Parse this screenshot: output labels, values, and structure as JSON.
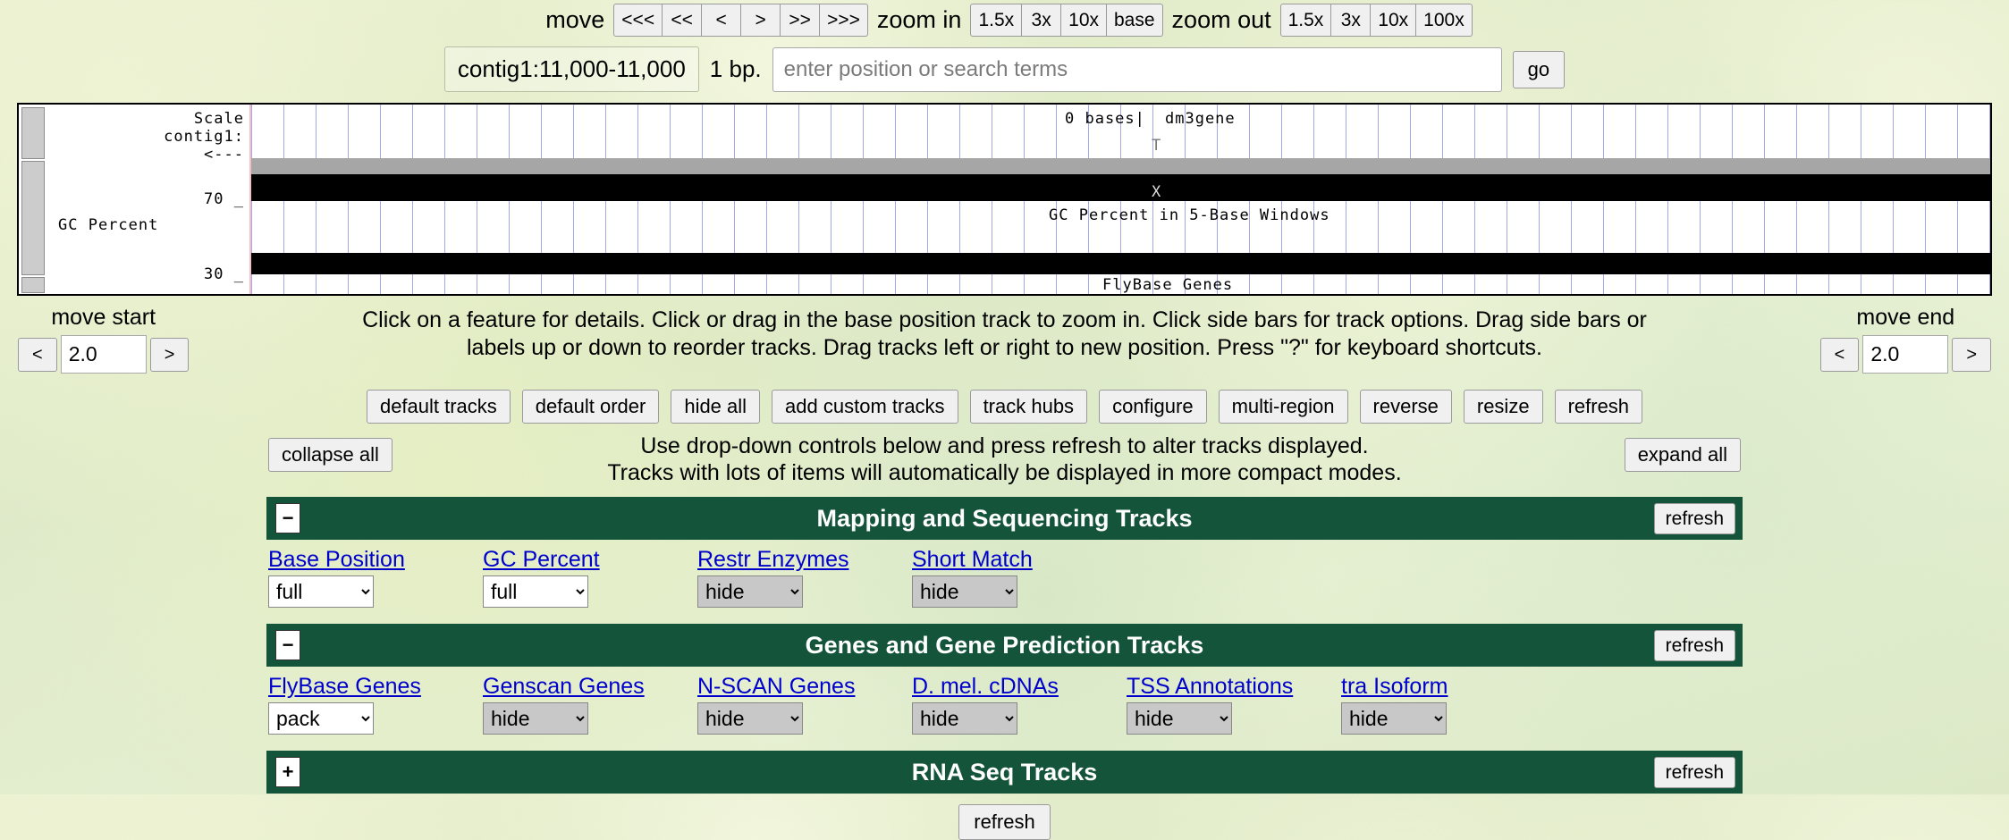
{
  "topnav": {
    "move_label": "move",
    "move_buttons": [
      "<<<",
      "<<",
      "<",
      ">",
      ">>",
      ">>>"
    ],
    "zoom_in_label": "zoom in",
    "zoom_in_buttons": [
      "1.5x",
      "3x",
      "10x",
      "base"
    ],
    "zoom_out_label": "zoom out",
    "zoom_out_buttons": [
      "1.5x",
      "3x",
      "10x",
      "100x"
    ]
  },
  "position": {
    "value": "contig1:11,000-11,000",
    "size": "1 bp.",
    "search_placeholder": "enter position or search terms",
    "search_value": "",
    "go_label": "go"
  },
  "browser_image": {
    "scale_label": "Scale",
    "contig_label": "contig1:",
    "arrow_label": "<---",
    "bases_label": "0 bases|",
    "assembly_label": "dm3gene",
    "base_letter_top": "T",
    "base_letter_bottom": "X",
    "gc_axis_high": "70 _",
    "gc_axis_low": "30 _",
    "gc_side_label": "GC Percent",
    "gc_track_title": "GC Percent in 5-Base Windows",
    "genes_track_title": "FlyBase Genes"
  },
  "move_start": {
    "title": "move start",
    "prev": "<",
    "value": "2.0",
    "next": ">"
  },
  "move_end": {
    "title": "move end",
    "prev": "<",
    "value": "2.0",
    "next": ">"
  },
  "instructions": {
    "line1": "Click on a feature for details. Click or drag in the base position track to zoom in. Click side bars for track options. Drag side bars or",
    "line2": "labels up or down to reorder tracks. Drag tracks left or right to new position. Press \"?\" for keyboard shortcuts."
  },
  "toolbar": {
    "buttons": [
      "default tracks",
      "default order",
      "hide all",
      "add custom tracks",
      "track hubs",
      "configure",
      "multi-region",
      "reverse",
      "resize",
      "refresh"
    ]
  },
  "hints": {
    "collapse_all": "collapse all",
    "expand_all": "expand all",
    "line1": "Use drop-down controls below and press refresh to alter tracks displayed.",
    "line2": "Tracks with lots of items will automatically be displayed in more compact modes."
  },
  "groups": [
    {
      "title": "Mapping and Sequencing Tracks",
      "toggle": "−",
      "refresh_label": "refresh",
      "tracks": [
        {
          "label": "Base Position",
          "value": "full",
          "state": "on"
        },
        {
          "label": "GC Percent",
          "value": "full",
          "state": "on"
        },
        {
          "label": "Restr Enzymes",
          "value": "hide",
          "state": "off"
        },
        {
          "label": "Short Match",
          "value": "hide",
          "state": "off"
        }
      ]
    },
    {
      "title": "Genes and Gene Prediction Tracks",
      "toggle": "−",
      "refresh_label": "refresh",
      "tracks": [
        {
          "label": "FlyBase Genes",
          "value": "pack",
          "state": "on"
        },
        {
          "label": "Genscan Genes",
          "value": "hide",
          "state": "off"
        },
        {
          "label": "N-SCAN Genes",
          "value": "hide",
          "state": "off"
        },
        {
          "label": "D. mel. cDNAs",
          "value": "hide",
          "state": "off"
        },
        {
          "label": "TSS Annotations",
          "value": "hide",
          "state": "off"
        },
        {
          "label": "tra Isoform",
          "value": "hide",
          "state": "off"
        }
      ]
    },
    {
      "title": "RNA Seq Tracks",
      "toggle": "+",
      "refresh_label": "refresh",
      "tracks": []
    }
  ],
  "bottom": {
    "refresh_label": "refresh"
  },
  "colors": {
    "group_header_green": "#13543a",
    "link_blue": "#0000cc",
    "select_off_gray": "#c8c8c8"
  }
}
